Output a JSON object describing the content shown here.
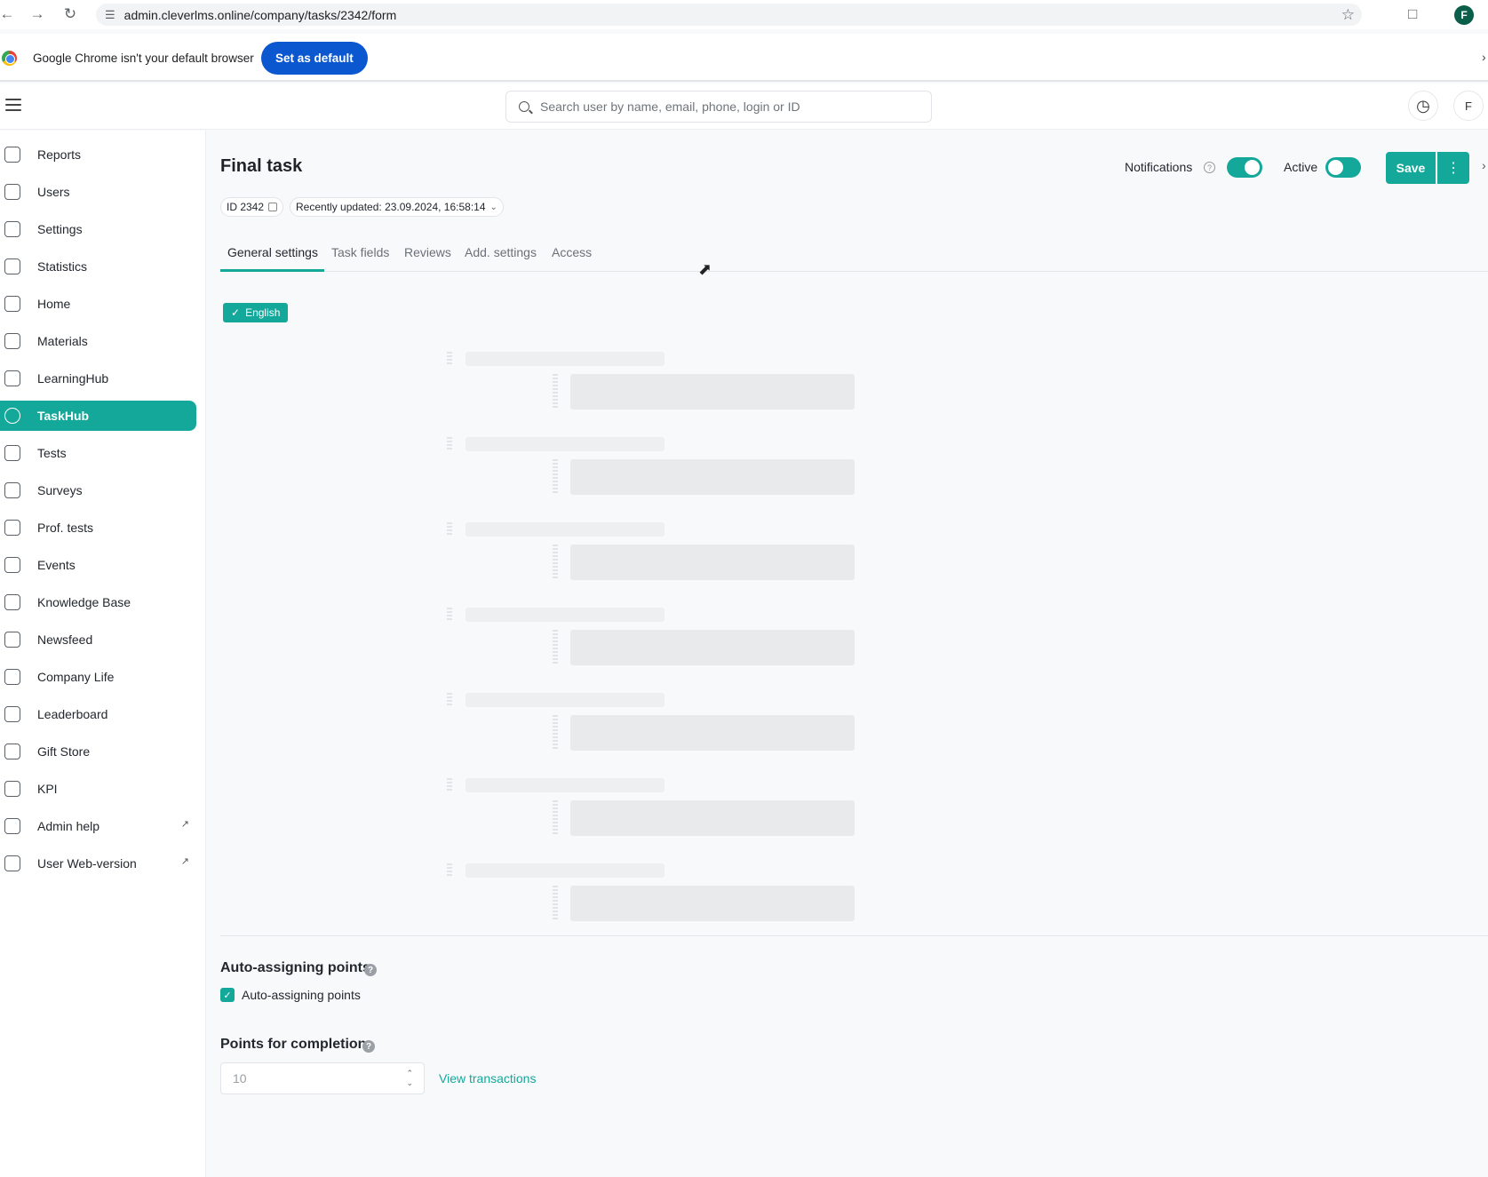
{
  "browser": {
    "url": "admin.cleverlms.online/company/tasks/2342/form",
    "profile_initial": "F",
    "infobar_text": "Google Chrome isn't your default browser",
    "set_default_label": "Set as default"
  },
  "header": {
    "search_placeholder": "Search user by name, email, phone, login or ID",
    "avatar_initial": "F"
  },
  "sidebar": {
    "items": [
      {
        "label": "Reports",
        "icon": "reports-icon"
      },
      {
        "label": "Users",
        "icon": "users-icon"
      },
      {
        "label": "Settings",
        "icon": "gear-icon"
      },
      {
        "label": "Statistics",
        "icon": "chart-icon"
      },
      {
        "label": "Home",
        "icon": "home-icon"
      },
      {
        "label": "Materials",
        "icon": "document-icon"
      },
      {
        "label": "LearningHub",
        "icon": "learning-icon"
      },
      {
        "label": "TaskHub",
        "icon": "check-circle-icon",
        "active": true
      },
      {
        "label": "Tests",
        "icon": "tests-icon"
      },
      {
        "label": "Surveys",
        "icon": "survey-icon"
      },
      {
        "label": "Prof. tests",
        "icon": "user-check-icon"
      },
      {
        "label": "Events",
        "icon": "calendar-icon"
      },
      {
        "label": "Knowledge Base",
        "icon": "info-icon"
      },
      {
        "label": "Newsfeed",
        "icon": "chat-icon"
      },
      {
        "label": "Company Life",
        "icon": "play-icon"
      },
      {
        "label": "Leaderboard",
        "icon": "trophy-icon"
      },
      {
        "label": "Gift Store",
        "icon": "gift-icon"
      },
      {
        "label": "KPI",
        "icon": "trend-icon"
      },
      {
        "label": "Admin help",
        "icon": "star-icon",
        "external": true
      },
      {
        "label": "User Web-version",
        "icon": "monitor-icon",
        "external": true
      }
    ]
  },
  "page": {
    "title": "Final task",
    "notifications_label": "Notifications",
    "active_label": "Active",
    "save_label": "Save",
    "id_chip": "ID 2342",
    "updated_chip": "Recently updated: 23.09.2024, 16:58:14",
    "tabs": [
      "General settings",
      "Task fields",
      "Reviews",
      "Add. settings",
      "Access"
    ],
    "language_badge": "English",
    "notifications_on": true,
    "active_on": true
  },
  "points": {
    "auto_title": "Auto-assigning points",
    "auto_checkbox_label": "Auto-assigning points",
    "auto_checked": true,
    "completion_title": "Points for completion",
    "completion_value": "10",
    "view_transactions": "View transactions"
  },
  "colors": {
    "accent": "#14a89a",
    "chrome_button": "#0b57d0"
  }
}
